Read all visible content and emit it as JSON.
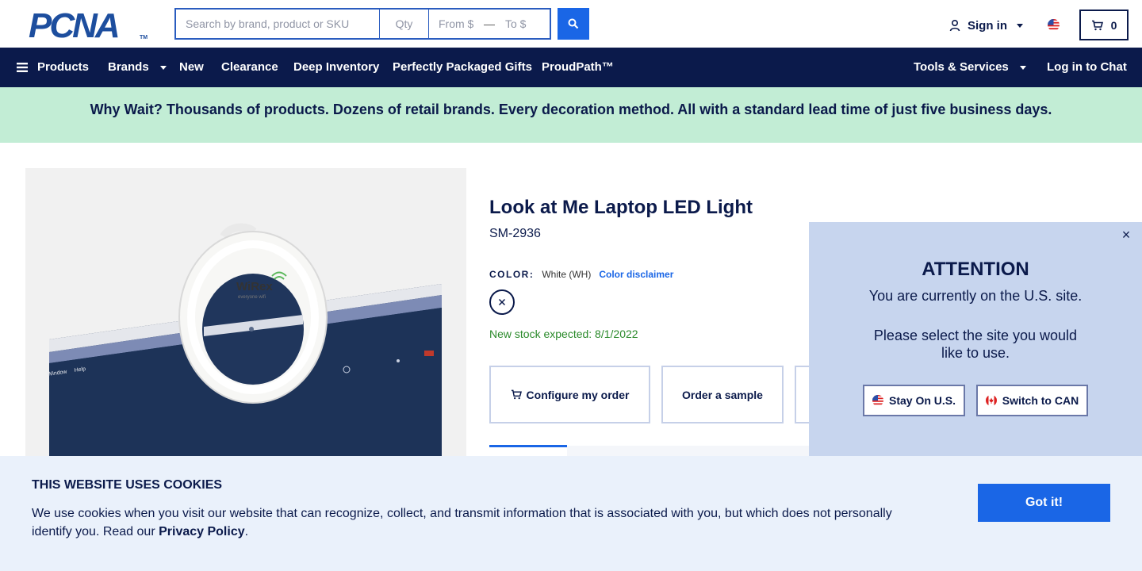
{
  "header": {
    "logo_text": "PCNA",
    "logo_tm": "TM",
    "search_placeholder": "Search by brand, product or SKU",
    "qty_placeholder": "Qty",
    "from_placeholder": "From $",
    "dash": "—",
    "to_placeholder": "To $",
    "signin_label": "Sign in",
    "cart_count": "0"
  },
  "nav": {
    "products": "Products",
    "brands": "Brands",
    "new": "New",
    "clearance": "Clearance",
    "deep_inventory": "Deep Inventory",
    "gifts": "Perfectly Packaged Gifts",
    "proudpath": "ProudPath™",
    "tools": "Tools & Services",
    "chat": "Log in to Chat"
  },
  "banner": {
    "text": "Why Wait? Thousands of products. Dozens of retail brands. Every decoration method. All with a standard lead time of just five business days."
  },
  "product": {
    "title": "Look at Me Laptop LED Light",
    "sku": "SM-2936",
    "color_label": "COLOR:",
    "color_value": "White (WH)",
    "color_disclaimer": "Color disclaimer",
    "image_brand": "WiRex",
    "image_tagline": "everyone wifi",
    "stock": "New stock expected: 8/1/2022",
    "configure_label": "Configure my order",
    "sample_label": "Order a sample"
  },
  "country_popup": {
    "close": "×",
    "title": "ATTENTION",
    "line1": "You are currently on the U.S. site.",
    "line2": "Please select the site you would like to use.",
    "stay_label": "Stay On U.S.",
    "switch_label": "Switch to CAN"
  },
  "cookie": {
    "title": "THIS WEBSITE USES COOKIES",
    "text_before": "We use cookies when you visit our website that can recognize, collect, and transmit information that is associated with you, but which does not personally identify you. Read our ",
    "link": "Privacy Policy",
    "text_after": ".",
    "button": "Got it!"
  },
  "colors": {
    "navy": "#0b1a4b",
    "accent_blue": "#1a66e6",
    "banner_green": "#c2edd5",
    "stock_green": "#2a8a2a",
    "popup_bg": "#c7d5ee",
    "cookie_bg": "#eaf1fb"
  }
}
